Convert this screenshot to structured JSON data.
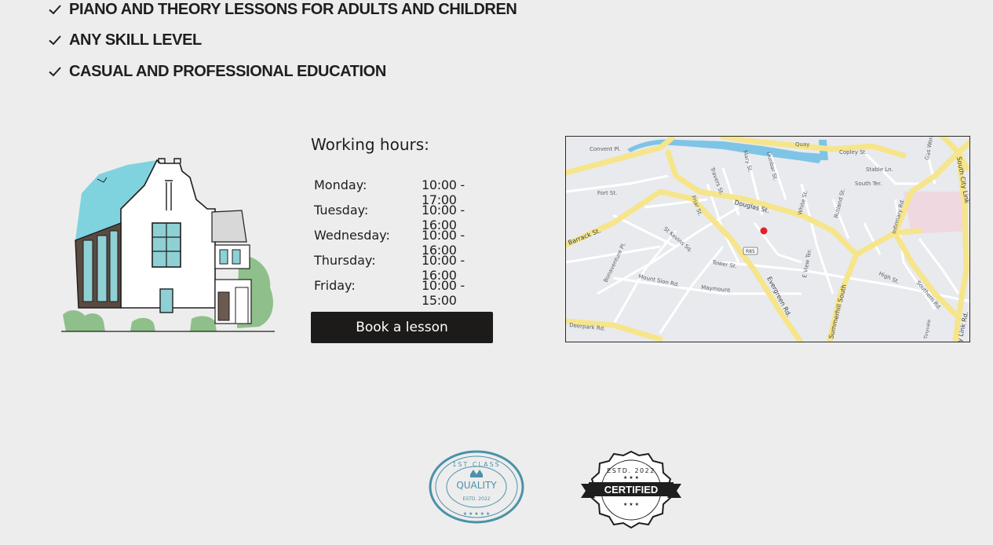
{
  "features": [
    {
      "text": "PIANO AND THEORY LESSONS FOR ADULTS AND CHILDREN",
      "icon": "check-icon"
    },
    {
      "text": "ANY SKILL LEVEL",
      "icon": "check-icon"
    },
    {
      "text": "CASUAL AND PROFESSIONAL EDUCATION",
      "icon": "check-icon"
    }
  ],
  "hours": {
    "title": "Working hours:",
    "rows": [
      {
        "day": "Monday:",
        "time": "10:00 - 17:00"
      },
      {
        "day": "Tuesday:",
        "time": "10:00 - 16:00"
      },
      {
        "day": "Wednesday:",
        "time": "10:00 - 16:00"
      },
      {
        "day": "Thursday:",
        "time": "10:00 - 16:00"
      },
      {
        "day": "Friday:",
        "time": "10:00 - 15:00"
      }
    ]
  },
  "cta": {
    "book_label": "Book a lesson"
  },
  "map": {
    "streets": [
      "Convent Pl.",
      "Quay",
      "Copley St.",
      "Stable Ln.",
      "South Ter.",
      "Fort St.",
      "Douglas St.",
      "Barrack St.",
      "St Kevins Sq.",
      "Tower St.",
      "Bonaventure Pl.",
      "Mount Sion Rd.",
      "Maymount",
      "Evergreen Rd.",
      "Summerhill South",
      "High St.",
      "Southern Rd.",
      "Deerpark Rd.",
      "Infirmary Rd.",
      "Rutland St.",
      "White St.",
      "E View Ter.",
      "Travers St.",
      "Mary St.",
      "Dunbar St.",
      "Friar St.",
      "Gas Works Ln.",
      "South City Link",
      "y Link Rd.",
      "Tinyvale"
    ],
    "route_badge": "R85",
    "marker_color": "#e0202a"
  },
  "badges": {
    "quality": {
      "top": "1ST CLASS",
      "main": "QUALITY",
      "bottom": "ESTD. 2022"
    },
    "certified": {
      "top": "ESTD. 2022",
      "main": "CERTIFIED"
    }
  },
  "colors": {
    "background": "#ededed",
    "button": "#1c1b1a",
    "house_accent": "#7fd3df",
    "greenery": "#8fbf8a"
  }
}
